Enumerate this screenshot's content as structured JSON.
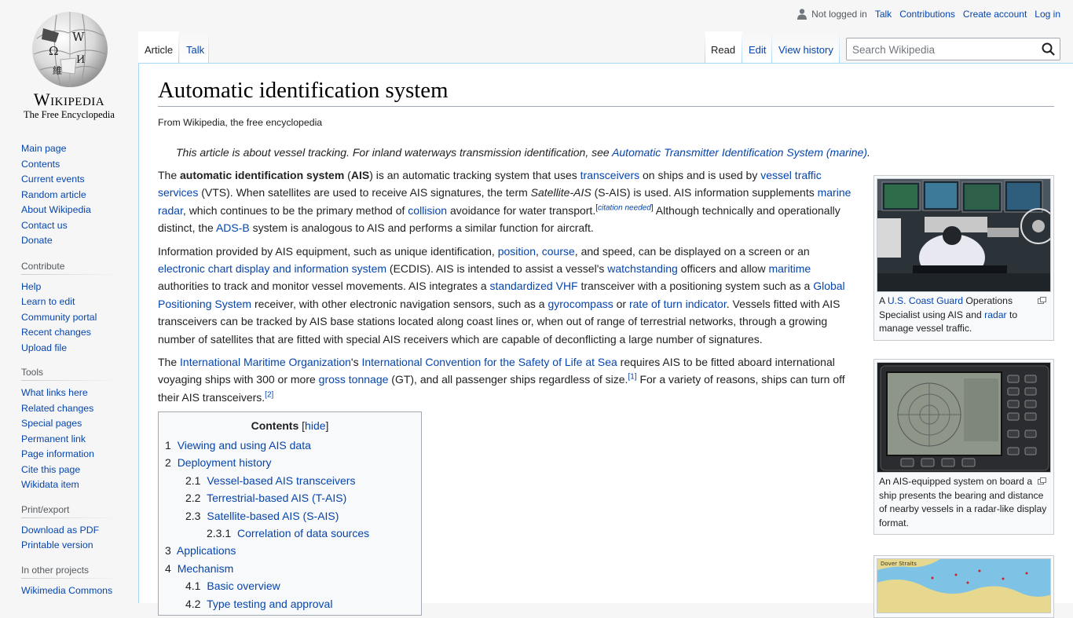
{
  "logo": {
    "wordmark": "Wikipedia",
    "tagline": "The Free Encyclopedia",
    "globe_letters": [
      "Ω",
      "W",
      "維",
      "И"
    ]
  },
  "personal": {
    "not_logged_in": "Not logged in",
    "talk": "Talk",
    "contributions": "Contributions",
    "create_account": "Create account",
    "log_in": "Log in"
  },
  "tabs": {
    "article": "Article",
    "talk": "Talk",
    "read": "Read",
    "edit": "Edit",
    "view_history": "View history"
  },
  "search": {
    "placeholder": "Search Wikipedia"
  },
  "sidebar": {
    "navigation": [
      "Main page",
      "Contents",
      "Current events",
      "Random article",
      "About Wikipedia",
      "Contact us",
      "Donate"
    ],
    "contribute": {
      "heading": "Contribute",
      "items": [
        "Help",
        "Learn to edit",
        "Community portal",
        "Recent changes",
        "Upload file"
      ]
    },
    "tools": {
      "heading": "Tools",
      "items": [
        "What links here",
        "Related changes",
        "Special pages",
        "Permanent link",
        "Page information",
        "Cite this page",
        "Wikidata item"
      ]
    },
    "print": {
      "heading": "Print/export",
      "items": [
        "Download as PDF",
        "Printable version"
      ]
    },
    "projects": {
      "heading": "In other projects",
      "items": [
        "Wikimedia Commons"
      ]
    }
  },
  "article": {
    "title": "Automatic identification system",
    "site_sub": "From Wikipedia, the free encyclopedia",
    "hatnote": {
      "text": "This article is about vessel tracking. For inland waterways transmission identification, see ",
      "link": "Automatic Transmitter Identification System (marine)",
      "end": "."
    },
    "p1": {
      "t1": "The ",
      "b1": "automatic identification system",
      "t2": " (",
      "b2": "AIS",
      "t3": ") is an automatic tracking system that uses ",
      "l1": "transceivers",
      "t4": " on ships and is used by ",
      "l2": "vessel traffic services",
      "t5": " (VTS). When satellites are used to receive AIS signatures, the term ",
      "i1": "Satellite-AIS",
      "t6": " (S-AIS) is used. AIS information supplements ",
      "l3": "marine radar",
      "t7": ", which continues to be the primary method of ",
      "l4": "collision",
      "t8": " avoidance for water transport.",
      "cite_open": "[",
      "cite": "citation needed",
      "cite_close": "]",
      "t9": " Although technically and operationally distinct, the ",
      "l5": "ADS-B",
      "t10": " system is analogous to AIS and performs a similar function for aircraft."
    },
    "p2": {
      "t1": "Information provided by AIS equipment, such as unique identification, ",
      "l1": "position",
      "t2": ", ",
      "l2": "course",
      "t3": ", and speed, can be displayed on a screen or an ",
      "l3": "electronic chart display and information system",
      "t4": " (ECDIS). AIS is intended to assist a vessel's ",
      "l4": "watchstanding",
      "t5": " officers and allow ",
      "l5": "maritime",
      "t6": " authorities to track and monitor vessel movements. AIS integrates a ",
      "l6": "standardized VHF",
      "t7": " transceiver with a positioning system such as a ",
      "l7": "Global Positioning System",
      "t8": " receiver, with other electronic navigation sensors, such as a ",
      "l8": "gyrocompass",
      "t9": " or ",
      "l9": "rate of turn indicator",
      "t10": ". Vessels fitted with AIS transceivers can be tracked by AIS base stations located along coast lines or, when out of range of terrestrial networks, through a growing number of satellites that are fitted with special AIS receivers which are capable of deconflicting a large number of signatures."
    },
    "p3": {
      "t1": "The ",
      "l1": "International Maritime Organization",
      "t2": "'s ",
      "l2": "International Convention for the Safety of Life at Sea",
      "t3": " requires AIS to be fitted aboard international voyaging ships with 300 or more ",
      "l3": "gross tonnage",
      "t4": " (GT), and all passenger ships regardless of size.",
      "ref1": "[1]",
      "t5": " For a variety of reasons, ships can turn off their AIS transceivers.",
      "ref2": "[2]"
    }
  },
  "toc": {
    "title": "Contents",
    "hide_open": " [",
    "hide": "hide",
    "hide_close": "]",
    "items": [
      {
        "num": "1",
        "text": "Viewing and using AIS data"
      },
      {
        "num": "2",
        "text": "Deployment history"
      },
      {
        "num": "2.1",
        "text": "Vessel-based AIS transceivers"
      },
      {
        "num": "2.2",
        "text": "Terrestrial-based AIS (T-AIS)"
      },
      {
        "num": "2.3",
        "text": "Satellite-based AIS (S-AIS)"
      },
      {
        "num": "2.3.1",
        "text": "Correlation of data sources"
      },
      {
        "num": "3",
        "text": "Applications"
      },
      {
        "num": "4",
        "text": "Mechanism"
      },
      {
        "num": "4.1",
        "text": "Basic overview"
      },
      {
        "num": "4.2",
        "text": "Type testing and approval"
      }
    ]
  },
  "thumbs": {
    "t1": {
      "c1": "A ",
      "l1": "U.S. Coast Guard",
      "c2": " Operations Specialist using AIS and ",
      "l2": "radar",
      "c3": " to manage vessel traffic."
    },
    "t2": {
      "caption": "An AIS-equipped system on board a ship presents the bearing and distance of nearby vessels in a radar-like display format."
    },
    "t3": {
      "label": "Dover Straits"
    }
  },
  "colors": {
    "link": "#0645ad",
    "border": "#a7d7f9",
    "text": "#202122"
  }
}
